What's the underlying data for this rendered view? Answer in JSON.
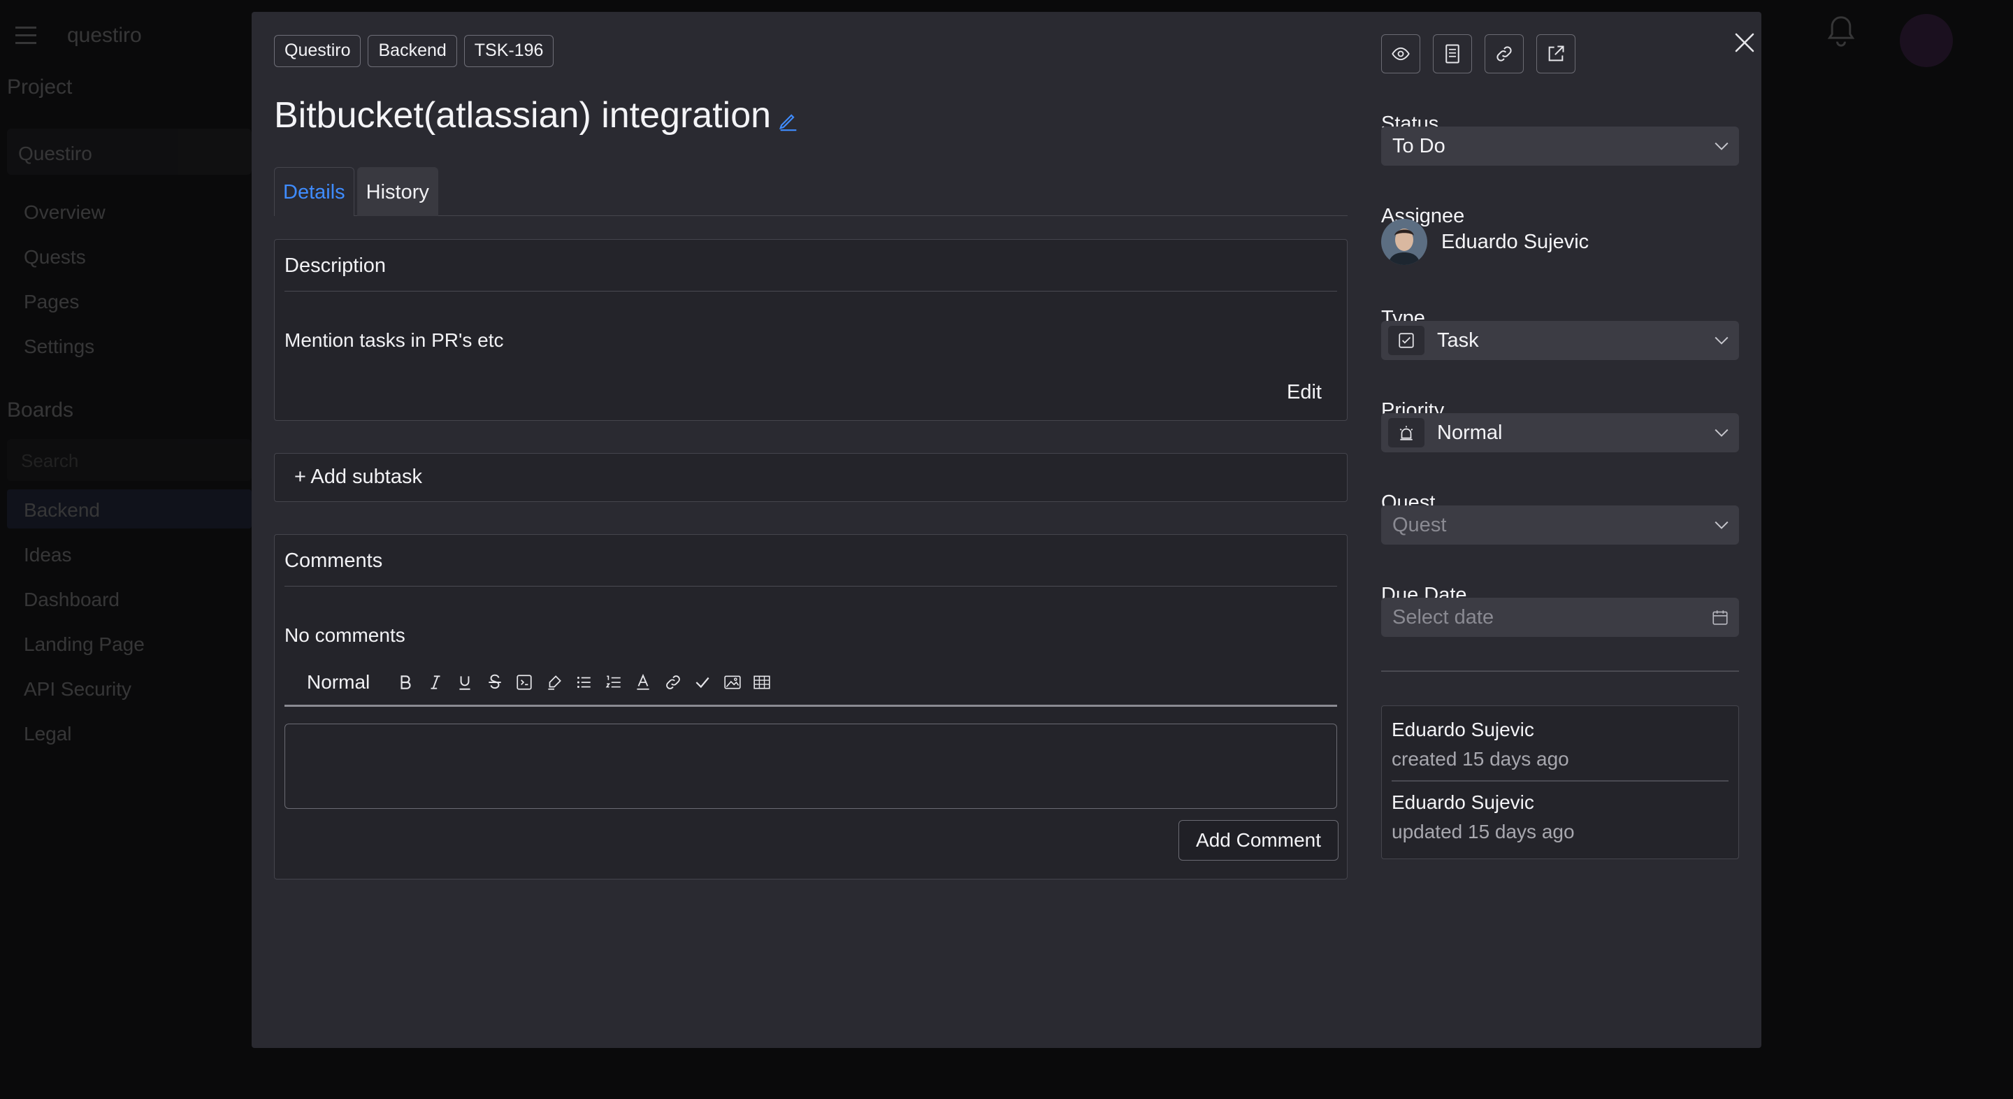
{
  "background": {
    "app_name": "questiro",
    "project_label": "Project",
    "project_value": "Questiro",
    "nav": [
      "Overview",
      "Quests",
      "Pages",
      "Settings"
    ],
    "boards_label": "Boards",
    "search_placeholder": "Search",
    "boards": [
      "Backend",
      "Ideas",
      "Dashboard",
      "Landing Page",
      "API Security",
      "Legal"
    ]
  },
  "breadcrumb": [
    "Questiro",
    "Backend",
    "TSK-196"
  ],
  "task": {
    "title": "Bitbucket(atlassian) integration"
  },
  "tabs": [
    {
      "label": "Details",
      "active": true
    },
    {
      "label": "History",
      "active": false
    }
  ],
  "description": {
    "header": "Description",
    "text": "Mention tasks in PR's etc",
    "edit_label": "Edit"
  },
  "subtask": {
    "add_label": "+ Add subtask"
  },
  "comments": {
    "header": "Comments",
    "empty_text": "No comments",
    "format_value": "Normal",
    "toolbar_icons": [
      "bold-icon",
      "italic-icon",
      "underline-icon",
      "strikethrough-icon",
      "code-block-icon",
      "highlight-icon",
      "bullet-list-icon",
      "ordered-list-icon",
      "text-color-icon",
      "link-icon",
      "checklist-icon",
      "image-icon",
      "table-icon"
    ],
    "add_button": "Add Comment"
  },
  "actions": [
    "eye-icon",
    "document-icon",
    "link-icon",
    "external-link-icon"
  ],
  "sidebar": {
    "status": {
      "label": "Status",
      "value": "To Do"
    },
    "assignee": {
      "label": "Assignee",
      "name": "Eduardo Sujevic"
    },
    "type": {
      "label": "Type",
      "value": "Task",
      "icon": "checkbox-icon"
    },
    "priority": {
      "label": "Priority",
      "value": "Normal",
      "icon": "alarm-icon"
    },
    "quest": {
      "label": "Quest",
      "placeholder": "Quest"
    },
    "due_date": {
      "label": "Due Date",
      "placeholder": "Select date"
    }
  },
  "activity": [
    {
      "name": "Eduardo Sujevic",
      "meta": "created 15 days ago"
    },
    {
      "name": "Eduardo Sujevic",
      "meta": "updated 15 days ago"
    }
  ],
  "colors": {
    "accent": "#3f8cff",
    "modal_bg": "#2a2a31",
    "select_bg": "#3c3c44"
  }
}
